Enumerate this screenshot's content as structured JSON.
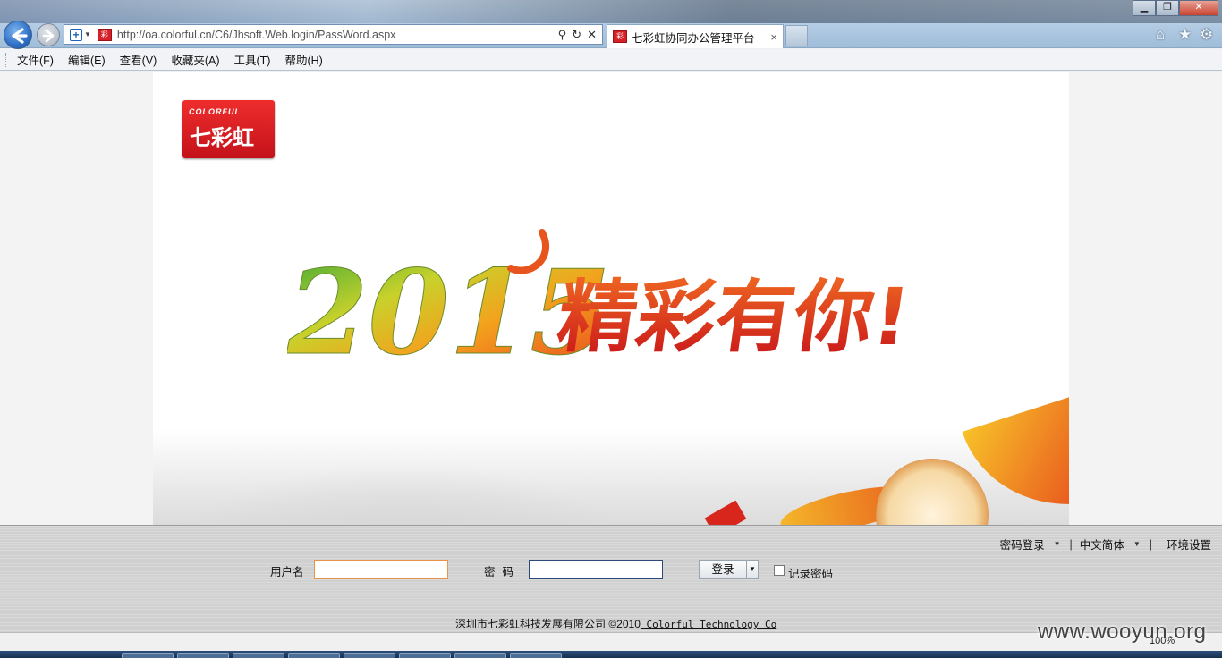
{
  "browser": {
    "url": "http://oa.colorful.cn/C6/Jhsoft.Web.login/PassWord.aspx",
    "tab_title": "七彩虹协同办公管理平台",
    "tab_close": "×",
    "menu": [
      "文件(F)",
      "编辑(E)",
      "查看(V)",
      "收藏夹(A)",
      "工具(T)",
      "帮助(H)"
    ],
    "window_controls": {
      "minimize": "▁",
      "restore": "❐",
      "close": "✕"
    },
    "icons": {
      "home": "⌂",
      "favorites": "★",
      "tools": "⚙",
      "search": "⚲",
      "refresh": "↻",
      "stop": "✕",
      "compat": "⊞"
    }
  },
  "banner": {
    "logo_small": "COLORFUL",
    "logo_main": "七彩虹",
    "headline_year": "2015",
    "headline_text": "精彩有你!"
  },
  "login": {
    "top_links": [
      "密码登录",
      "中文简体",
      "环境设置"
    ],
    "username_label": "用户名",
    "password_label": "密码",
    "login_button": "登录",
    "remember_label": "记录密码",
    "copyright_cn": "深圳市七彩虹科技发展有限公司 ©2010",
    "copyright_en": " Colorful Technology Co"
  },
  "status": {
    "zoom": "100%"
  },
  "watermark": "www.wooyun.org"
}
